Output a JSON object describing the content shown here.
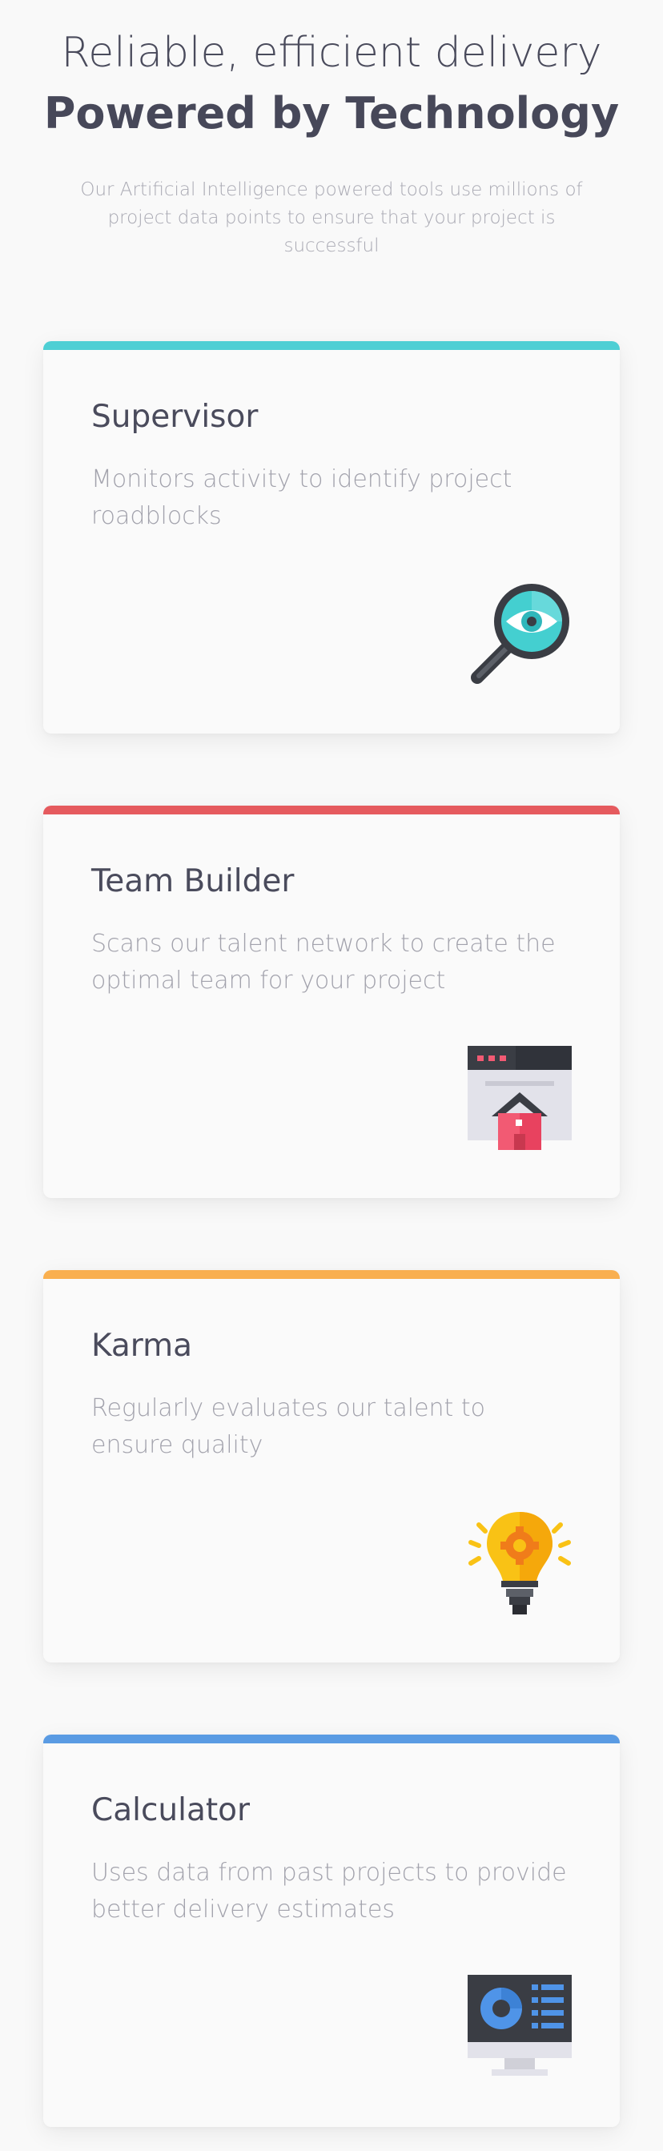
{
  "header": {
    "headline_light": "Reliable, efficient delivery",
    "headline_bold": "Powered by Technology",
    "intro": "Our Artificial Intelligence powered tools use millions of project data points to ensure that your project is successful"
  },
  "cards": [
    {
      "title": "Supervisor",
      "description": "Monitors activity to identify project roadblocks",
      "accent": "#4ecfd4",
      "icon": "magnifier-eye-icon"
    },
    {
      "title": "Team Builder",
      "description": "Scans our talent network to create the optimal team for your project",
      "accent": "#e55a5e",
      "icon": "browser-house-icon"
    },
    {
      "title": "Karma",
      "description": "Regularly evaluates our talent to ensure quality",
      "accent": "#f9af4f",
      "icon": "lightbulb-gear-icon"
    },
    {
      "title": "Calculator",
      "description": "Uses data from past projects to provide better delivery estimates",
      "accent": "#5a9be3",
      "icon": "monitor-dashboard-icon"
    }
  ]
}
